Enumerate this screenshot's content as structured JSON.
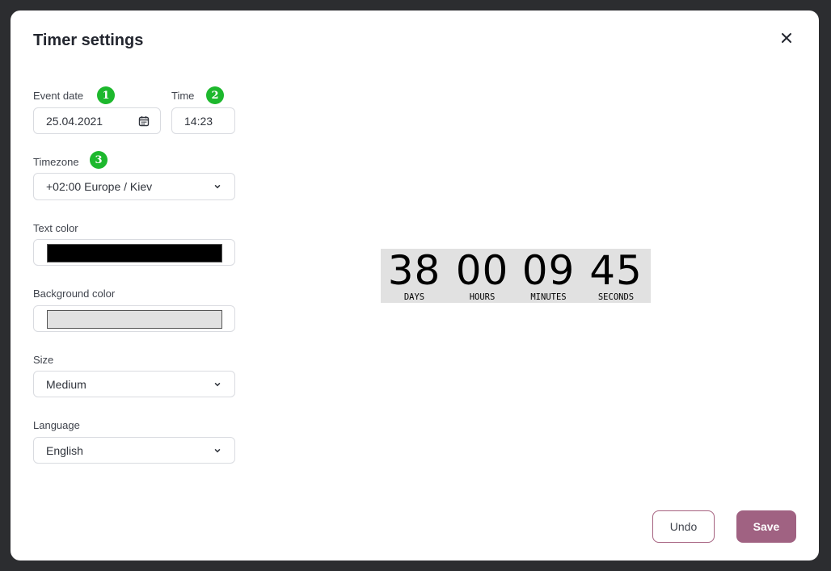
{
  "modal": {
    "title": "Timer settings",
    "close_icon": "close-icon"
  },
  "form": {
    "event_date": {
      "label": "Event date",
      "value": "25.04.2021",
      "badge": "1",
      "icon": "calendar-icon"
    },
    "time": {
      "label": "Time",
      "value": "14:23",
      "badge": "2"
    },
    "timezone": {
      "label": "Timezone",
      "value": "+02:00 Europe / Kiev",
      "badge": "3",
      "icon": "chevron-down-icon"
    },
    "text_color": {
      "label": "Text color",
      "value": "#000000"
    },
    "background_color": {
      "label": "Background color",
      "value": "#e1e1e1"
    },
    "size": {
      "label": "Size",
      "value": "Medium",
      "icon": "chevron-down-icon"
    },
    "language": {
      "label": "Language",
      "value": "English",
      "icon": "chevron-down-icon"
    }
  },
  "preview": {
    "units": [
      {
        "value": "38",
        "caption": "DAYS"
      },
      {
        "value": "00",
        "caption": "HOURS"
      },
      {
        "value": "09",
        "caption": "MINUTES"
      },
      {
        "value": "45",
        "caption": "SECONDS"
      }
    ]
  },
  "actions": {
    "undo_label": "Undo",
    "save_label": "Save"
  },
  "colors": {
    "badge": "#1db82d",
    "accent": "#a06282",
    "backdrop": "#2c2d30"
  }
}
